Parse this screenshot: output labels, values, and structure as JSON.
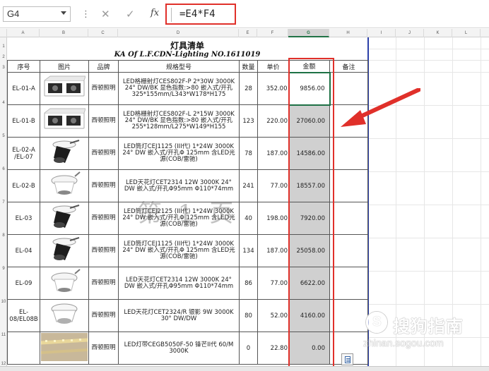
{
  "formula_bar": {
    "name_box": "G4",
    "cancel_glyph": "✕",
    "enter_glyph": "✓",
    "fx_label": "fx",
    "formula": "=E4*F4"
  },
  "columns": [
    "A",
    "B",
    "C",
    "D",
    "E",
    "F",
    "G",
    "H",
    "I",
    "J",
    "K",
    "L"
  ],
  "selected_column": "G",
  "rows": [
    "1",
    "2",
    "3",
    "4",
    "5",
    "6",
    "7",
    "8",
    "9",
    "10",
    "11",
    "12"
  ],
  "sheet": {
    "title": "灯具清单",
    "subtitle": "KA Of L.F.CDN-Lighting NO.1611019",
    "headers": {
      "seq": "序号",
      "image": "图片",
      "brand": "品牌",
      "spec": "规格型号",
      "qty": "数量",
      "price": "单价",
      "amount": "金额",
      "remark": "备注"
    },
    "items": [
      {
        "code": "EL-01-A",
        "brand": "西顿照明",
        "spec": "LED格栅射灯CES802F-P 2*30W 3000K 24° DW/BK 显色指数:>80 嵌入式/开孔 325*155mm/L343*W178*H175",
        "qty": "28",
        "price": "352.00",
        "amount": "9856.00",
        "image": "grille-double"
      },
      {
        "code": "EL-01-B",
        "brand": "西顿照明",
        "spec": "LED格栅射灯CES802F-L 2*15W 3000K 24° DW/BK 显色指数:>80 嵌入式/开孔 255*128mm/L275*W149*H155",
        "qty": "123",
        "price": "220.00",
        "amount": "27060.00",
        "image": "grille-double"
      },
      {
        "code": "EL-02-A /EL-07",
        "brand": "西顿照明",
        "spec": "LED筒灯CEJ1125 (III代) 1*24W 3000K 24° DW 嵌入式/开孔Φ 125mm 含LED光源(COB/雷驰)",
        "qty": "78",
        "price": "187.00",
        "amount": "14586.00",
        "image": "spot-tilt"
      },
      {
        "code": "EL-02-B",
        "brand": "西顿照明",
        "spec": "LED天花灯CET2314 12W 3000K 24° DW 嵌入式/开孔Φ95mm Φ110*74mm",
        "qty": "241",
        "price": "77.00",
        "amount": "18557.00",
        "image": "downlight-white"
      },
      {
        "code": "EL-03",
        "brand": "西顿照明",
        "spec": "LED筒灯CEJ2125 (III代) 1*24W 3000K 24° DW 嵌入式/开孔Φ 125mm 含LED光源(COB/雷驰)",
        "qty": "40",
        "price": "198.00",
        "amount": "7920.00",
        "image": "spot-tilt"
      },
      {
        "code": "EL-04",
        "brand": "西顿照明",
        "spec": "LED筒灯CEJ1125 (III代) 1*24W 3000K 24° DW 嵌入式/开孔Φ 125mm 含LED光源(COB/雷驰)",
        "qty": "134",
        "price": "187.00",
        "amount": "25058.00",
        "image": "spot-tilt"
      },
      {
        "code": "EL-09",
        "brand": "西顿照明",
        "spec": "LED天花灯CET2314 12W 3000K 24° DW 嵌入式/开孔Φ95mm Φ110*74mm",
        "qty": "86",
        "price": "77.00",
        "amount": "6622.00",
        "image": "downlight-white"
      },
      {
        "code": "EL-08/EL08B",
        "brand": "西顿照明",
        "spec": "LED天花灯CET2324/R 银影 9W 3000K 30° DW/DW",
        "qty": "80",
        "price": "52.00",
        "amount": "4160.00",
        "image": "downlight-round"
      },
      {
        "code": "",
        "brand": "西顿照明",
        "spec": "LED灯带CEGB5050F-50 锋芒II代 60/M 3000K",
        "qty": "0",
        "price": "22.80",
        "amount": "0.00",
        "image": "led-strip"
      }
    ]
  },
  "watermark_page": "第 1 页",
  "watermarks": {
    "brand": "搜狗指南",
    "logo_letter": "S",
    "site": "zhinan.sogou.com"
  },
  "colors": {
    "highlight_red": "#e0302a",
    "excel_green": "#1e7145",
    "print_border_blue": "#2b3fa8",
    "amount_fill": "#d0d0d0"
  }
}
